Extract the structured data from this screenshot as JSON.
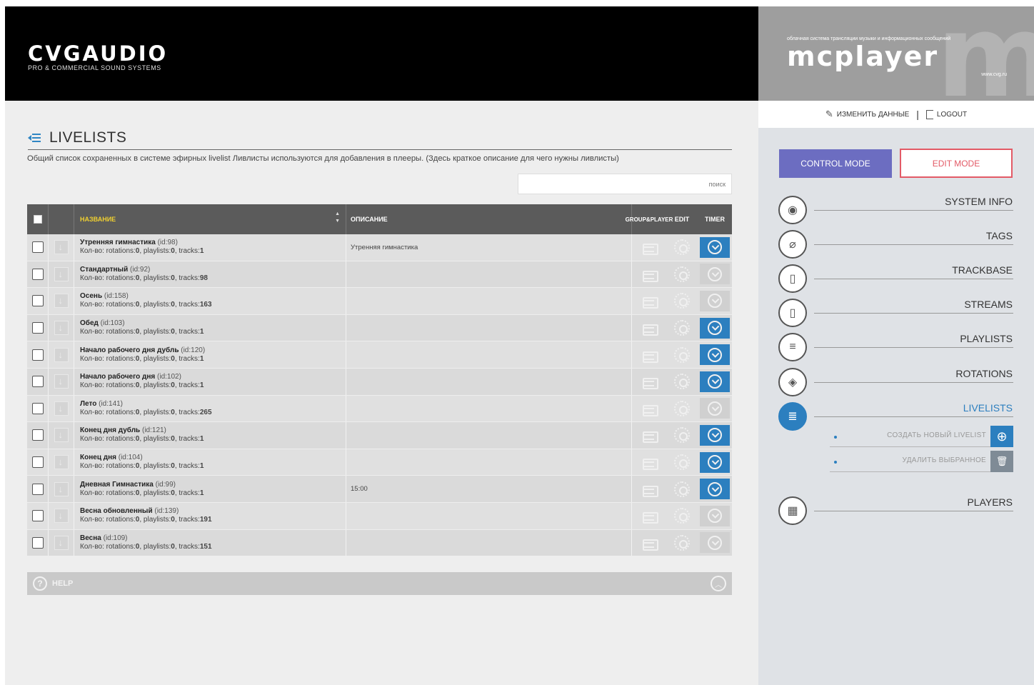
{
  "header": {
    "brand_name": "CVGAUDIO",
    "brand_tagline": "PRO & COMMERCIAL SOUND SYSTEMS",
    "product_tagline": "облачная система трансляции музыки и информационных сообщений",
    "product_name": "mcplayer",
    "product_url": "www.cvg.ru"
  },
  "account": {
    "edit_profile": "ИЗМЕНИТЬ ДАННЫЕ",
    "separator": "|",
    "logout": "LOGOUT"
  },
  "page": {
    "title": "LIVELISTS",
    "description": "Общий список сохраненных в системе эфирных livelist Ливлисты используются для добавления в плееры. (Здесь краткое описание для чего нужны ливлисты)",
    "search_placeholder": "поиск"
  },
  "table": {
    "columns": {
      "name": "НАЗВАНИЕ",
      "description": "ОПИСАНИЕ",
      "group_player_1": "GROUP&",
      "group_player_2": "PLAYER",
      "edit": "EDIT",
      "timer": "TIMER"
    },
    "rows": [
      {
        "name": "Утренняя гимнастика",
        "id": "(id:98)",
        "stats_prefix": "Кол-во: rotations:",
        "rotations": "0",
        "playlists_label": ", playlists:",
        "playlists": "0",
        "tracks_label": ", tracks:",
        "tracks": "1",
        "description": "Утренняя гимнастика",
        "timer_on": true
      },
      {
        "name": "Стандартный",
        "id": "(id:92)",
        "stats_prefix": "Кол-во: rotations:",
        "rotations": "0",
        "playlists_label": ", playlists:",
        "playlists": "0",
        "tracks_label": ", tracks:",
        "tracks": "98",
        "description": "",
        "timer_on": false
      },
      {
        "name": "Осень",
        "id": "(id:158)",
        "stats_prefix": "Кол-во: rotations:",
        "rotations": "0",
        "playlists_label": ", playlists:",
        "playlists": "0",
        "tracks_label": ", tracks:",
        "tracks": "163",
        "description": "",
        "timer_on": false
      },
      {
        "name": "Обед",
        "id": "(id:103)",
        "stats_prefix": "Кол-во: rotations:",
        "rotations": "0",
        "playlists_label": ", playlists:",
        "playlists": "0",
        "tracks_label": ", tracks:",
        "tracks": "1",
        "description": "",
        "timer_on": true
      },
      {
        "name": "Начало рабочего дня дубль",
        "id": "(id:120)",
        "stats_prefix": "Кол-во: rotations:",
        "rotations": "0",
        "playlists_label": ", playlists:",
        "playlists": "0",
        "tracks_label": ", tracks:",
        "tracks": "1",
        "description": "",
        "timer_on": true
      },
      {
        "name": "Начало рабочего дня",
        "id": "(id:102)",
        "stats_prefix": "Кол-во: rotations:",
        "rotations": "0",
        "playlists_label": ", playlists:",
        "playlists": "0",
        "tracks_label": ", tracks:",
        "tracks": "1",
        "description": "",
        "timer_on": true
      },
      {
        "name": "Лето",
        "id": "(id:141)",
        "stats_prefix": "Кол-во: rotations:",
        "rotations": "0",
        "playlists_label": ", playlists:",
        "playlists": "0",
        "tracks_label": ", tracks:",
        "tracks": "265",
        "description": "",
        "timer_on": false
      },
      {
        "name": "Конец дня дубль",
        "id": "(id:121)",
        "stats_prefix": "Кол-во: rotations:",
        "rotations": "0",
        "playlists_label": ", playlists:",
        "playlists": "0",
        "tracks_label": ", tracks:",
        "tracks": "1",
        "description": "",
        "timer_on": true
      },
      {
        "name": "Конец дня",
        "id": "(id:104)",
        "stats_prefix": "Кол-во: rotations:",
        "rotations": "0",
        "playlists_label": ", playlists:",
        "playlists": "0",
        "tracks_label": ", tracks:",
        "tracks": "1",
        "description": "",
        "timer_on": true
      },
      {
        "name": "Дневная Гимнастика",
        "id": "(id:99)",
        "stats_prefix": "Кол-во: rotations:",
        "rotations": "0",
        "playlists_label": ", playlists:",
        "playlists": "0",
        "tracks_label": ", tracks:",
        "tracks": "1",
        "description": "15:00",
        "timer_on": true
      },
      {
        "name": "Весна обновленный",
        "id": "(id:139)",
        "stats_prefix": "Кол-во: rotations:",
        "rotations": "0",
        "playlists_label": ", playlists:",
        "playlists": "0",
        "tracks_label": ", tracks:",
        "tracks": "191",
        "description": "",
        "timer_on": false
      },
      {
        "name": "Весна",
        "id": "(id:109)",
        "stats_prefix": "Кол-во: rotations:",
        "rotations": "0",
        "playlists_label": ", playlists:",
        "playlists": "0",
        "tracks_label": ", tracks:",
        "tracks": "151",
        "description": "",
        "timer_on": false
      }
    ]
  },
  "help": {
    "label": "HELP"
  },
  "modes": {
    "control": "CONTROL MODE",
    "edit": "EDIT MODE"
  },
  "nav": {
    "items": [
      {
        "label": "SYSTEM INFO",
        "icon": "eye-icon",
        "active": false
      },
      {
        "label": "TAGS",
        "icon": "tag-icon",
        "active": false
      },
      {
        "label": "TRACKBASE",
        "icon": "audio-file-icon",
        "active": false
      },
      {
        "label": "STREAMS",
        "icon": "stream-file-icon",
        "active": false
      },
      {
        "label": "PLAYLISTS",
        "icon": "list-icon",
        "active": false
      },
      {
        "label": "ROTATIONS",
        "icon": "layers-icon",
        "active": false
      },
      {
        "label": "LIVELISTS",
        "icon": "livelist-icon",
        "active": true
      },
      {
        "label": "PLAYERS",
        "icon": "player-icon",
        "active": false
      }
    ],
    "subitems": [
      {
        "label": "СОЗДАТЬ НОВЫЙ LIVELIST",
        "icon": "plus-circle-icon"
      },
      {
        "label": "УДАЛИТЬ ВЫБРАННОЕ",
        "icon": "trash-icon"
      }
    ]
  },
  "colors": {
    "accent_blue": "#2c7fbf",
    "control_mode": "#6c6dc1",
    "edit_mode": "#e35a66",
    "header_name": "#f0d030"
  }
}
